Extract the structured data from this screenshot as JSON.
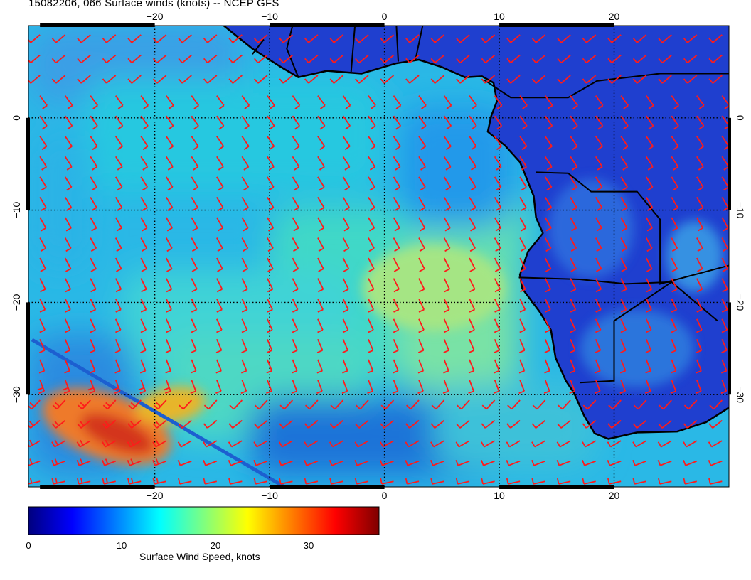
{
  "title": "15082206, 066 Surface winds (knots) -- NCEP GFS",
  "map": {
    "lon_range": [
      -31,
      30
    ],
    "lat_range": [
      -40,
      10
    ],
    "lon_ticks": [
      -20,
      -10,
      0,
      10,
      20
    ],
    "lat_ticks": [
      0,
      -10,
      -20,
      -30
    ],
    "lon_tick_labels": [
      "−20",
      "−10",
      "0",
      "10",
      "20"
    ],
    "lat_tick_labels": [
      "0",
      "−10",
      "−20",
      "−30"
    ],
    "barb_color": "#ff1a1a",
    "coast_color": "#000000",
    "grid": true
  },
  "colorbar": {
    "title": "Surface Wind Speed, knots",
    "range": [
      0,
      37.5
    ],
    "ticks": [
      0,
      10,
      20,
      30
    ],
    "tick_labels": [
      "0",
      "10",
      "20",
      "30"
    ],
    "colormap": [
      "#00007f",
      "#0000ff",
      "#007fff",
      "#00ffff",
      "#7fff7f",
      "#ffff00",
      "#ff7f00",
      "#ff0000",
      "#7f0000"
    ]
  }
}
